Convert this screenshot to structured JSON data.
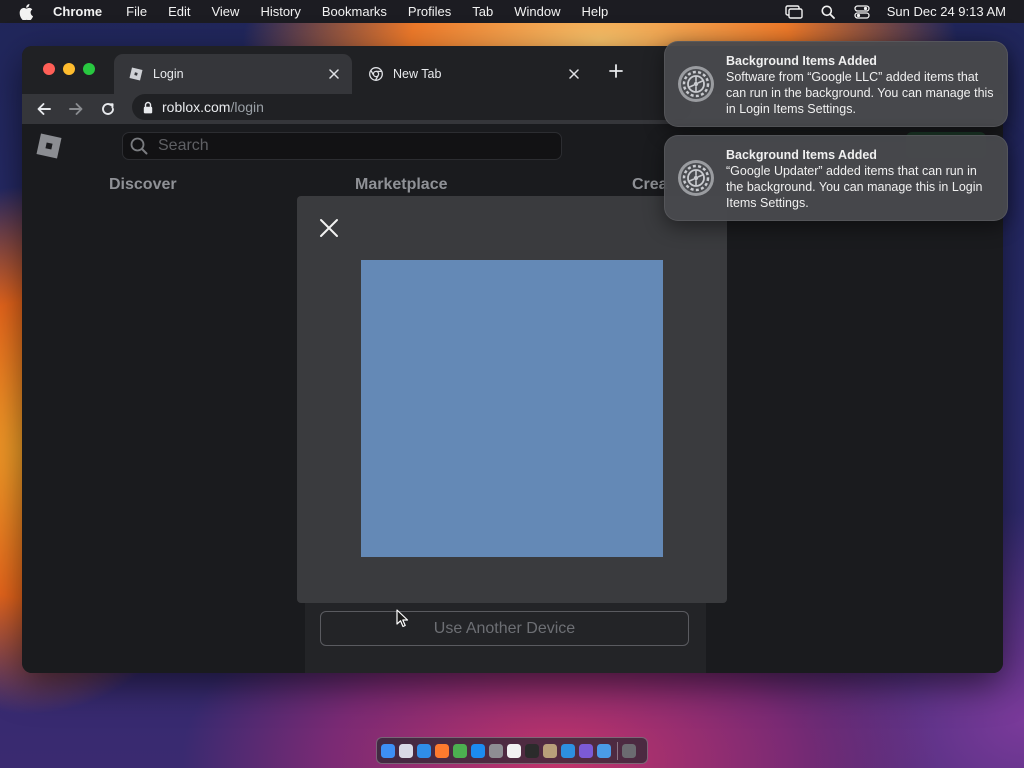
{
  "menubar": {
    "app_name": "Chrome",
    "items": [
      "File",
      "Edit",
      "View",
      "History",
      "Bookmarks",
      "Profiles",
      "Tab",
      "Window",
      "Help"
    ],
    "clock": "Sun Dec 24  9:13 AM"
  },
  "browser": {
    "tabs": [
      {
        "title": "Login",
        "active": true
      },
      {
        "title": "New Tab",
        "active": false
      }
    ],
    "url_host": "roblox.com",
    "url_path": "/login"
  },
  "page": {
    "search_placeholder": "Search",
    "nav": {
      "discover": "Discover",
      "marketplace": "Marketplace",
      "create": "Crea"
    },
    "use_another_device": "Use Another Device"
  },
  "modal": {
    "qr_color": "#6489b6"
  },
  "notifications": [
    {
      "title": "Background Items Added",
      "body": "Software from “Google LLC” added items that can run in the background. You can manage this in Login Items Settings."
    },
    {
      "title": "Background Items Added",
      "body": "“Google Updater” added items that can run in the background. You can manage this in Login Items Settings."
    }
  ],
  "dock": {
    "apps": [
      {
        "name": "finder",
        "color": "#3d8ff5"
      },
      {
        "name": "launchpad",
        "color": "#d9d9e6"
      },
      {
        "name": "safari",
        "color": "#2f8de8"
      },
      {
        "name": "firefox",
        "color": "#ff7a2e"
      },
      {
        "name": "chrome",
        "color": "#4caf50"
      },
      {
        "name": "app-store",
        "color": "#1c8bf0"
      },
      {
        "name": "system-settings",
        "color": "#8e8e93"
      },
      {
        "name": "text-editor",
        "color": "#f2f2f2"
      },
      {
        "name": "terminal",
        "color": "#2b2b2b"
      },
      {
        "name": "script-editor",
        "color": "#b9a07a"
      },
      {
        "name": "vs-code",
        "color": "#2d8fe0"
      },
      {
        "name": "visual-studio",
        "color": "#7c5ad6"
      },
      {
        "name": "cloud-app",
        "color": "#4a9be8"
      },
      {
        "name": "trash",
        "color": "#6b6b70"
      }
    ]
  }
}
